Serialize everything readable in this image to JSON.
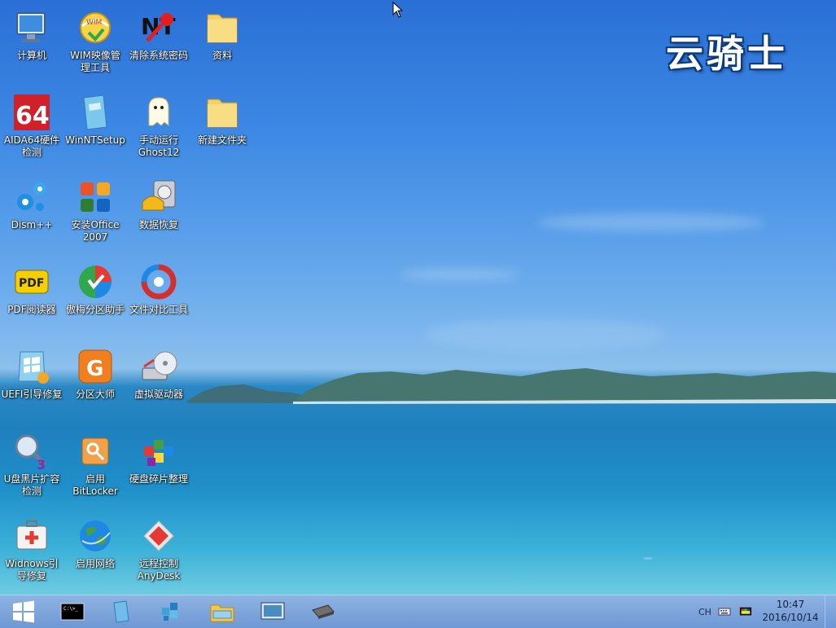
{
  "brand": {
    "text": "云骑士"
  },
  "desktop_icons": [
    {
      "label": "计算机",
      "icon": "computer-icon"
    },
    {
      "label": "WIM映像管\n理工具",
      "icon": "wim-tool-icon"
    },
    {
      "label": "清除系统密码",
      "icon": "password-reset-icon"
    },
    {
      "label": "资料",
      "icon": "folder-icon"
    },
    {
      "label": "AIDA64硬件\n检测",
      "icon": "aida64-icon"
    },
    {
      "label": "WinNTSetup",
      "icon": "winntsetup-icon"
    },
    {
      "label": "手动运行\nGhost12",
      "icon": "ghost-icon"
    },
    {
      "label": "新建文件夹",
      "icon": "folder-icon"
    },
    {
      "label": "Dism++",
      "icon": "dism-gears-icon"
    },
    {
      "label": "安装Office\n2007",
      "icon": "office-icon"
    },
    {
      "label": "数据恢复",
      "icon": "data-recovery-icon"
    },
    {
      "label": "PDF阅读器",
      "icon": "pdf-icon"
    },
    {
      "label": "傲梅分区助手",
      "icon": "partition-assistant-icon"
    },
    {
      "label": "文件对比工具",
      "icon": "file-compare-icon"
    },
    {
      "label": "UEFI引导修复",
      "icon": "uefi-repair-icon"
    },
    {
      "label": "分区大师",
      "icon": "partition-master-icon"
    },
    {
      "label": "虚拟驱动器",
      "icon": "virtual-drive-icon"
    },
    {
      "label": "U盘黑片扩容\n检测",
      "icon": "usb-check-icon"
    },
    {
      "label": "启用\nBitLocker",
      "icon": "bitlocker-icon"
    },
    {
      "label": "硬盘碎片整理",
      "icon": "defrag-icon"
    },
    {
      "label": "Widnows引\n导修复",
      "icon": "windows-repair-icon"
    },
    {
      "label": "启用网络",
      "icon": "network-globe-icon"
    },
    {
      "label": "远程控制\nAnyDesk",
      "icon": "anydesk-icon"
    }
  ],
  "taskbar": {
    "items": [
      {
        "name": "cmd-taskbar-icon"
      },
      {
        "name": "winntsetup-taskbar-icon"
      },
      {
        "name": "dism-taskbar-icon"
      },
      {
        "name": "explorer-taskbar-icon"
      },
      {
        "name": "screen-taskbar-icon"
      },
      {
        "name": "memory-taskbar-icon"
      }
    ],
    "lang": "CH",
    "time": "10:47",
    "date": "2016/10/14"
  }
}
